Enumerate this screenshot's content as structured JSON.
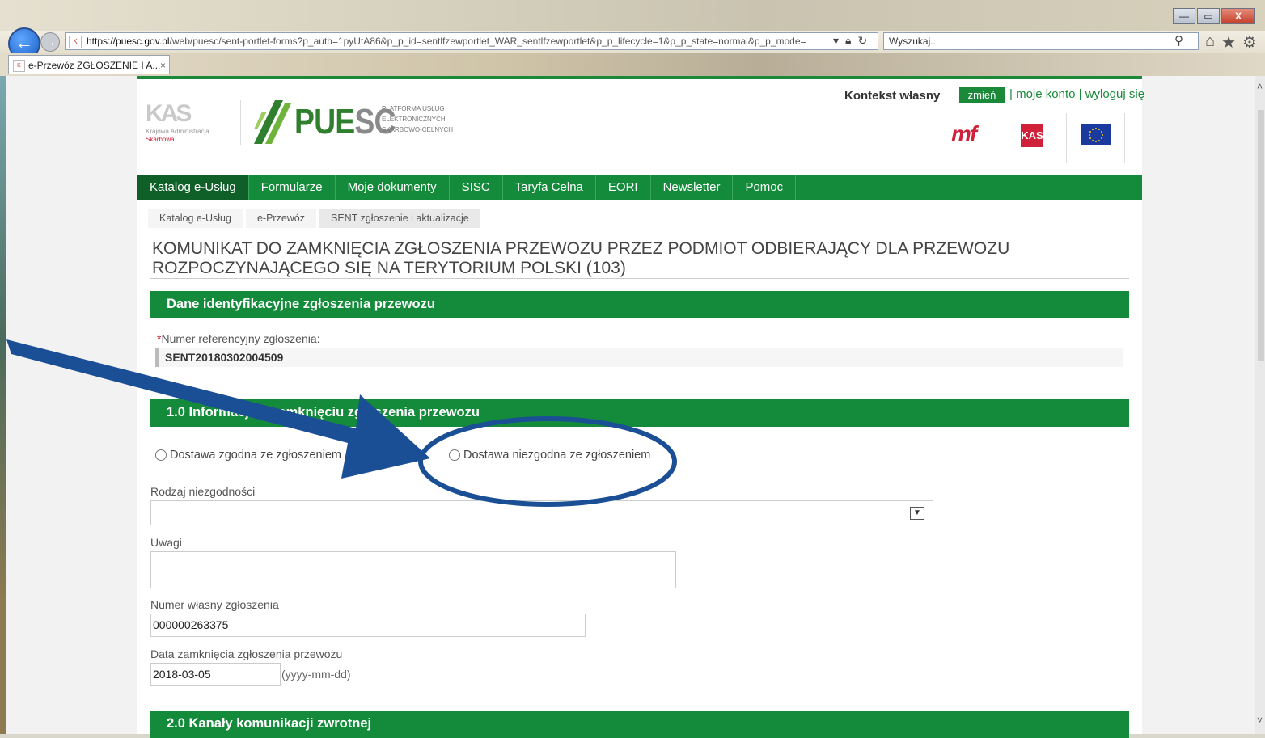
{
  "browser": {
    "url_domain": "https://puesc.gov.pl",
    "url_rest": "/web/puesc/sent-portlet-forms?p_auth=1pyUtA86&p_p_id=sentlfzewportlet_WAR_sentlfzewportlet&p_p_lifecycle=1&p_p_state=normal&p_p_mode=",
    "search_placeholder": "Wyszukaj...",
    "tab_title": "e-Przewóz ZGŁOSZENIE I A...",
    "tab_close": "×",
    "win_min": "—",
    "win_max": "▭",
    "win_close": "X"
  },
  "header": {
    "kas_mark": "KAS",
    "kas_line1": "Krajowa Administracja",
    "kas_line2": "Skarbowa",
    "puesc_word_a": "PUE",
    "puesc_word_b": "SC",
    "puesc_sub1": "PLATFORMA USŁUG",
    "puesc_sub2": "ELEKTRONICZNYCH",
    "puesc_sub3": "SKARBOWO-CELNYCH",
    "kontekst": "Kontekst własny",
    "zmien": "zmień",
    "link_sep": "|",
    "moje_konto": "moje konto",
    "wyloguj": "wyloguj się",
    "mf": "mf",
    "kas_badge": "KAS"
  },
  "nav": {
    "items": [
      "Katalog e-Usług",
      "Formularze",
      "Moje dokumenty",
      "SISC",
      "Taryfa Celna",
      "EORI",
      "Newsletter",
      "Pomoc"
    ]
  },
  "breadcrumb": [
    "Katalog e-Usług",
    "e-Przewóz",
    "SENT zgłoszenie i aktualizacje"
  ],
  "page": {
    "title": "KOMUNIKAT DO ZAMKNIĘCIA ZGŁOSZENIA PRZEWOZU PRZEZ PODMIOT ODBIERAJĄCY DLA PRZEWOZU ROZPOCZYNAJĄCEGO SIĘ NA TERYTORIUM POLSKI (103)"
  },
  "section1": {
    "heading": "Dane identyfikacyjne zgłoszenia przewozu",
    "req_mark": "*",
    "ref_label": "Numer referencyjny zgłoszenia:",
    "ref_value": "SENT20180302004509"
  },
  "section2": {
    "heading": "1.0 Informacja o zamknięciu zgłoszenia przewozu",
    "radio1": "Dostawa zgodna ze zgłoszeniem",
    "radio2": "Dostawa niezgodna ze zgłoszeniem",
    "rodzaj_label": "Rodzaj niezgodności",
    "rodzaj_value": "",
    "uwagi_label": "Uwagi",
    "uwagi_value": "",
    "numer_label": "Numer własny zgłoszenia",
    "numer_value": "000000263375",
    "data_label": "Data zamknięcia zgłoszenia przewozu",
    "data_value": "2018-03-05",
    "data_hint": "(yyyy-mm-dd)"
  },
  "section3": {
    "heading": "2.0 Kanały komunikacji zwrotnej"
  },
  "colors": {
    "green": "#138b3a",
    "dark_green": "#0f5f28",
    "red": "#d0213a",
    "annotation_blue": "#1a4f96"
  },
  "icons": [
    "back-arrow-icon",
    "forward-arrow-icon",
    "lock-icon",
    "refresh-icon",
    "search-icon",
    "home-icon",
    "star-icon",
    "gear-icon",
    "chevron-down-icon"
  ]
}
